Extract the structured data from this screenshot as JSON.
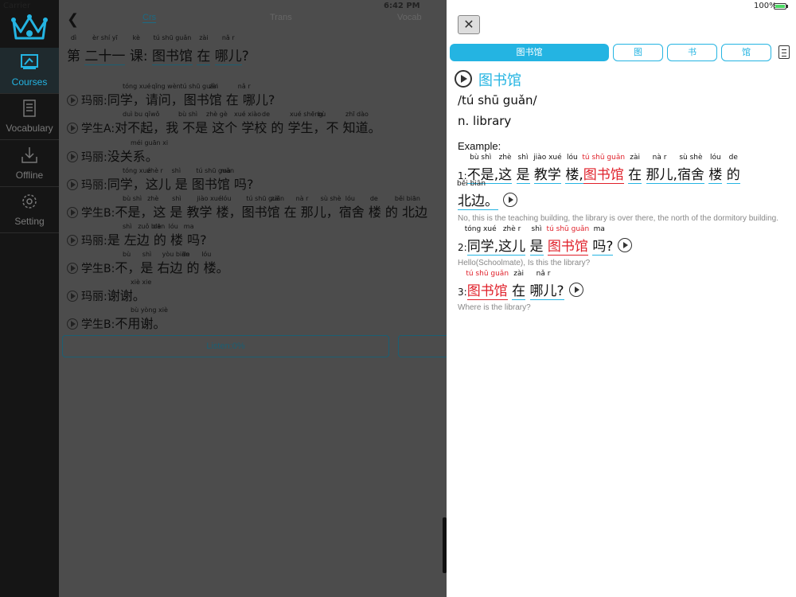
{
  "status": {
    "carrier": "Carrier",
    "time": "6:42 PM",
    "battery": "100%"
  },
  "sidebar": {
    "items": [
      {
        "label": "Courses"
      },
      {
        "label": "Vocabulary"
      },
      {
        "label": "Offline"
      },
      {
        "label": "Setting"
      }
    ]
  },
  "main": {
    "tabs": [
      "Crs",
      "Trans",
      "Vocab"
    ],
    "lesson_title": {
      "prefix": "第",
      "num": "二十一",
      "mid": "课",
      "colon": ":",
      "w1": "图书馆",
      "w2": "在",
      "w3": "哪儿",
      "q": "?"
    },
    "lesson_title_py": {
      "prefix": "dì",
      "num": "èr shí yī",
      "mid": "kè",
      "w1": "tú shū guǎn",
      "w2": "zài",
      "w3": "nǎ r"
    },
    "lines": [
      {
        "speaker": "玛丽:",
        "text": "同学，请问，图书馆 在 哪儿?"
      },
      {
        "speaker": "学生A:",
        "text": "对不起，我 不是 这个 学校 的 学生，不 知道。"
      },
      {
        "speaker": "玛丽:",
        "text": "没关系。"
      },
      {
        "speaker": "玛丽:",
        "text": "同学，这儿 是 图书馆 吗?"
      },
      {
        "speaker": "学生B:",
        "text": "不是，这 是 教学 楼，图书馆 在 那儿，宿舍 楼 的 北边"
      },
      {
        "speaker": "玛丽:",
        "text": "是 左边 的 楼 吗?"
      },
      {
        "speaker": "学生B:",
        "text": "不，是 右边 的 楼。"
      },
      {
        "speaker": "玛丽:",
        "text": "谢谢。"
      },
      {
        "speaker": "学生B:",
        "text": "不用谢。"
      }
    ],
    "pinyin": {
      "l1": [
        "tóng xué",
        "qǐng wèn",
        "tú shū guǎn",
        "zài",
        "nǎ r"
      ],
      "l2": [
        "duì bu qǐ",
        "wǒ",
        "bù shì",
        "zhè gè",
        "xué xiào",
        "de",
        "xué shēng",
        "bù",
        "zhī dào"
      ],
      "l3": [
        "méi guān xi"
      ],
      "l4": [
        "tóng xué",
        "zhè r",
        "shì",
        "tú shū guǎn",
        "ma"
      ],
      "l5": [
        "bù shì",
        "zhè",
        "shì",
        "jiào xué",
        "lóu",
        "tú shū guǎn",
        "zài",
        "nà r",
        "sù shè",
        "lóu",
        "de",
        "běi biān"
      ],
      "l6": [
        "shì",
        "zuǒ biān",
        "de",
        "lóu",
        "ma"
      ],
      "l7": [
        "bù",
        "shì",
        "yòu biān",
        "de",
        "lóu"
      ],
      "l8": [
        "xiè xie"
      ],
      "l9": [
        "bù yòng xiè"
      ]
    },
    "listen_label": "Listen:0%"
  },
  "panel": {
    "close_label": "✕",
    "tabs": [
      "图书馆",
      "图",
      "书",
      "馆"
    ],
    "headword": "图书馆",
    "phonetic": "/tú shū guǎn/",
    "definition": "n.  library",
    "example_label": "Example:",
    "examples": [
      {
        "num": "1:",
        "words": [
          {
            "py": "bù shì",
            "w": "不是"
          },
          {
            "py": "",
            "w": ","
          },
          {
            "py": "zhè",
            "w": "这"
          },
          {
            "py": "shì",
            "w": "是"
          },
          {
            "py": "jiào xué",
            "w": "教学"
          },
          {
            "py": "lóu",
            "w": "楼"
          },
          {
            "py": "",
            "w": ","
          },
          {
            "py": "tú shū guǎn",
            "w": "图书馆"
          },
          {
            "py": "zài",
            "w": "在"
          },
          {
            "py": "nà r",
            "w": "那儿"
          },
          {
            "py": "",
            "w": ","
          },
          {
            "py": "sù shè",
            "w": "宿舍"
          },
          {
            "py": "lóu",
            "w": "楼"
          },
          {
            "py": "de",
            "w": "的"
          }
        ],
        "cont": {
          "py": "běi biān",
          "w": "北边",
          "end": "。"
        },
        "translation": "No, this is the teaching building, the library is over there, the north of the dormitory building."
      },
      {
        "num": "2:",
        "words": [
          {
            "py": "tóng xué",
            "w": "同学"
          },
          {
            "py": "",
            "w": ","
          },
          {
            "py": "zhè r",
            "w": "这儿"
          },
          {
            "py": "shì",
            "w": "是"
          },
          {
            "py": "tú shū guǎn",
            "w": "图书馆"
          },
          {
            "py": "ma",
            "w": "吗"
          },
          {
            "py": "",
            "w": "?"
          }
        ],
        "translation": "Hello(Schoolmate), Is this the library?"
      },
      {
        "num": "3:",
        "words": [
          {
            "py": "tú shū guǎn",
            "w": "图书馆"
          },
          {
            "py": "zài",
            "w": "在"
          },
          {
            "py": "nǎ r",
            "w": "哪儿"
          },
          {
            "py": "",
            "w": "?"
          }
        ],
        "translation": "Where is the library?"
      }
    ]
  }
}
